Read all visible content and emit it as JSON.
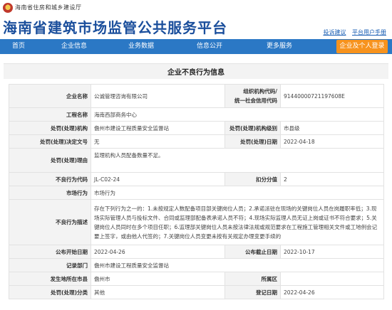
{
  "header": {
    "ministry_text": "海南省住房和城乡建设厅",
    "site_title": "海南省建筑市场监管公共服务平台",
    "links": [
      "投诉建议",
      "平台用户手册"
    ]
  },
  "nav": {
    "items": [
      "首页",
      "企业信息",
      "业务数据",
      "信息公开",
      "更多服务"
    ],
    "login": "企业及个人登录"
  },
  "page_title": "企业不良行为信息",
  "details": {
    "company_name": {
      "label": "企业名称",
      "value": "公诚管理咨询有限公司"
    },
    "org_code": {
      "label1": "组织机构代码/",
      "label2": "统一社会信用代码",
      "value": "91440000721197608E"
    },
    "project_name": {
      "label": "工程名称",
      "value": "海南西部商务中心"
    },
    "penalty_agency": {
      "label": "处罚(处理)机构",
      "value": "儋州市建设工程质量安全监督站"
    },
    "agency_level": {
      "label": "处罚(处理)机构级别",
      "value": "市县级"
    },
    "decision_doc": {
      "label": "处罚(处理)决定文号",
      "value": "无"
    },
    "penalty_date": {
      "label": "处罚(处理)日期",
      "value": "2022-04-18"
    },
    "penalty_reason": {
      "label": "处罚(处理)理由",
      "value": "监理机构人员配备数量不足。"
    },
    "behavior_code": {
      "label": "不良行为代码",
      "value": "JL-C02-24"
    },
    "deduction": {
      "label": "扣分分值",
      "value": "2"
    },
    "market_behavior": {
      "label": "市场行为",
      "value": "市场行为"
    },
    "behavior_desc": {
      "label": "不良行为描述",
      "value": "存在下列行为之一的：1.未按规定人数配备项目部关键岗位人员；2.承诺派驻在现场的关键岗位人员在岗履职率低；3.现场实际管理人员与投标文件、合同或监理部配备表承诺人员不符；4.现场实际监理人员无证上岗或证书不符合要求；5.关键岗位人员同时在多个项目任职；6.监理部关键岗位人员未按法律法规或规范要求在工程施工管理相关文件或工地例会记要上签字，或由他人代签的；7.关键岗位人员变更未按有关规定办理变更手续的"
    },
    "publish_start": {
      "label": "公布开始日期",
      "value": "2022-04-26"
    },
    "publish_end": {
      "label": "公布截止日期",
      "value": "2022-10-17"
    },
    "record_unit": {
      "label": "记录部门",
      "value": "儋州市建设工程质量安全监督站"
    },
    "location": {
      "label": "发生地所在市县",
      "value": "儋州市"
    },
    "district": {
      "label": "所属区",
      "value": ""
    },
    "category": {
      "label": "处罚(处理)分类",
      "value": "其他"
    },
    "record_date": {
      "label": "登记日期",
      "value": "2022-04-26"
    }
  },
  "colors": {
    "nav_bg": "#2b78c5",
    "login_bg": "#f7931e",
    "title": "#1b4f9c",
    "label_bg": "#f3f3f3"
  }
}
